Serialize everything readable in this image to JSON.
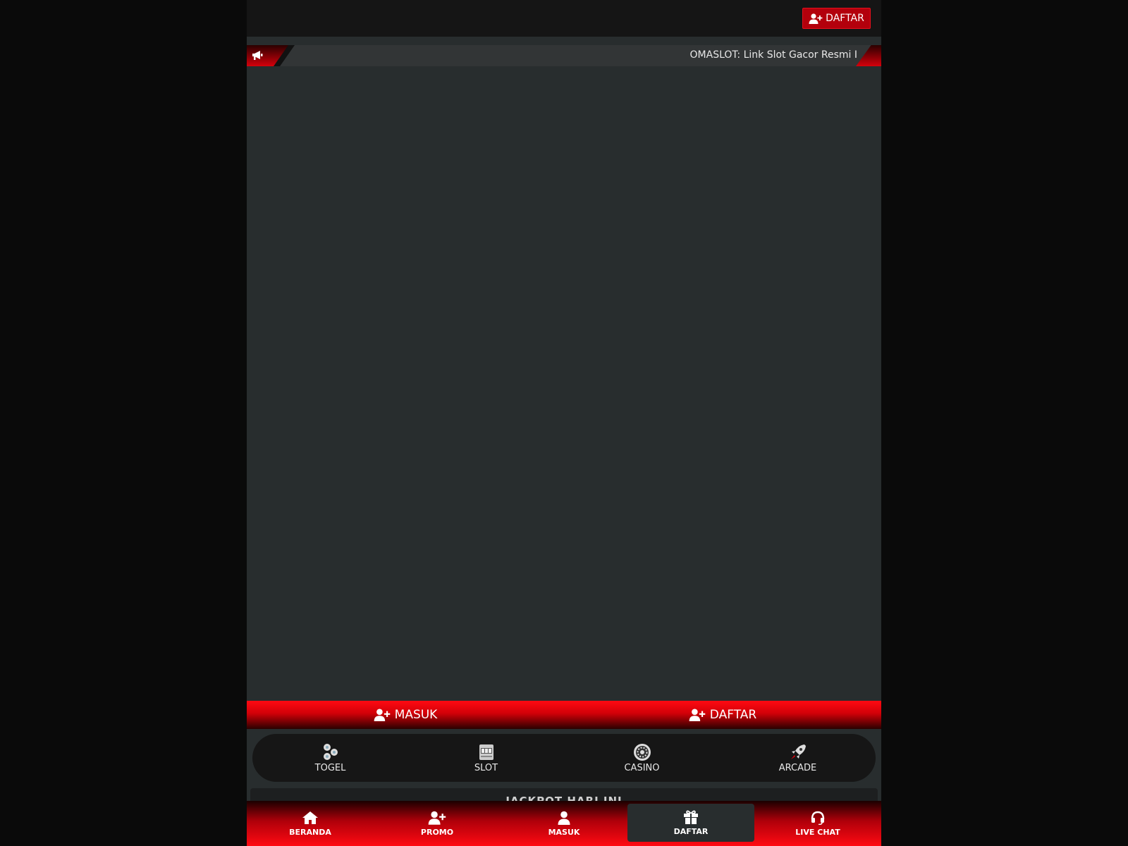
{
  "header": {
    "daftar_button_label": "DAFTAR"
  },
  "marquee": {
    "icon": "megaphone-icon",
    "text": "OMASLOT: Link Slot Gacor Resmi I"
  },
  "auth": {
    "masuk_label": "MASUK",
    "daftar_label": "DAFTAR"
  },
  "game_nav": {
    "items": [
      {
        "label": "TOGEL",
        "icon": "lottery-balls-icon"
      },
      {
        "label": "SLOT",
        "icon": "slot-machine-icon"
      },
      {
        "label": "CASINO",
        "icon": "roulette-icon"
      },
      {
        "label": "ARCADE",
        "icon": "rocket-icon"
      }
    ]
  },
  "jackpot": {
    "label": "JACKPOT HARI INI"
  },
  "bottom_nav": {
    "items": [
      {
        "label": "BERANDA",
        "icon": "home-icon"
      },
      {
        "label": "PROMO",
        "icon": "user-plus-icon"
      },
      {
        "label": "MASUK",
        "icon": "user-icon"
      },
      {
        "label": "DAFTAR",
        "icon": "gift-icon",
        "active": true
      },
      {
        "label": "LIVE CHAT",
        "icon": "headset-icon"
      }
    ]
  },
  "colors": {
    "accent_red": "#e3000b",
    "panel": "#282d2e",
    "background": "#0a0a0a"
  }
}
